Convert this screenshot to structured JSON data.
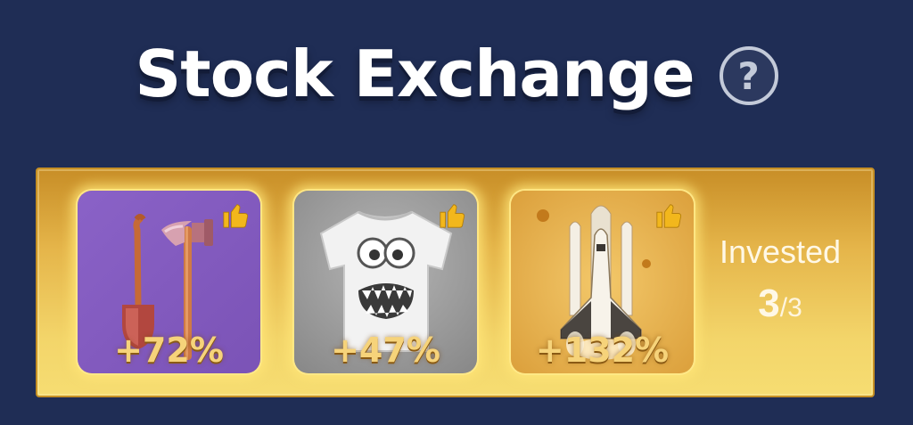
{
  "header": {
    "title": "Stock Exchange",
    "help_icon": "question-circle-icon",
    "help_glyph": "?"
  },
  "cards": [
    {
      "item": "shovel-and-axe",
      "change": "+72%",
      "liked": true,
      "background": "#8e63c4"
    },
    {
      "item": "monster-t-shirt",
      "change": "+47%",
      "liked": true,
      "background": "#9a9a9a"
    },
    {
      "item": "space-shuttle",
      "change": "+132%",
      "liked": true,
      "background": "#e0a946"
    }
  ],
  "invested": {
    "label": "Invested",
    "current": "3",
    "separator": "/",
    "total": "3"
  },
  "colors": {
    "background": "#1f2d55",
    "panel_gold": "#e5b54a",
    "thumb_icon": "#f2b71c"
  }
}
